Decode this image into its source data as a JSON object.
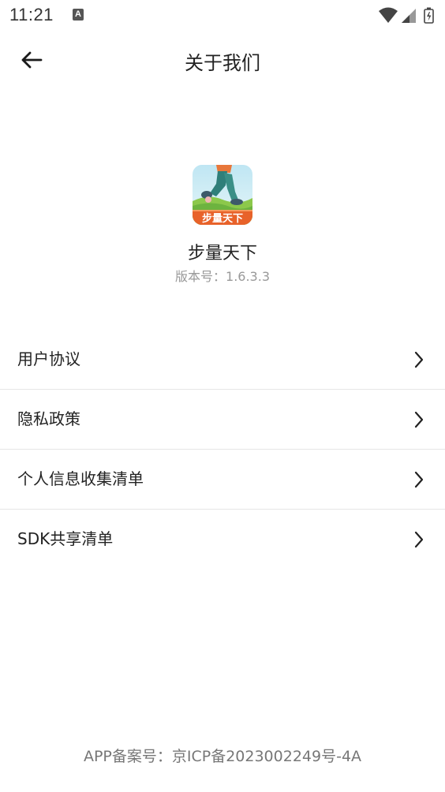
{
  "status_bar": {
    "time": "11:21",
    "notification_icon": "A",
    "icons": [
      "wifi-icon",
      "signal-icon",
      "battery-icon"
    ]
  },
  "header": {
    "back_icon": "arrow-left-icon",
    "title": "关于我们"
  },
  "app": {
    "logo_text": "步量天下",
    "name": "步量天下",
    "version_label": "版本号：",
    "version": "1.6.3.3"
  },
  "menu": {
    "items": [
      {
        "label": "用户协议"
      },
      {
        "label": "隐私政策"
      },
      {
        "label": "个人信息收集清单"
      },
      {
        "label": "SDK共享清单"
      }
    ]
  },
  "footer": {
    "label": "APP备案号：",
    "value": "京ICP备2023002249号-4A"
  },
  "colors": {
    "title_text": "#222222",
    "secondary_text": "#999999",
    "divider": "#e6e6e6",
    "logo_banner": "#e8622a"
  }
}
